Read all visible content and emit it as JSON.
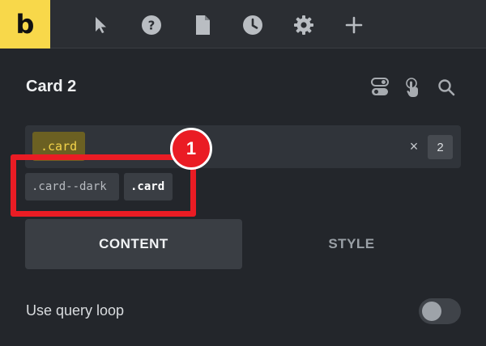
{
  "toolbar": {
    "logo_text": "b",
    "icons": [
      "cursor-icon",
      "help-icon",
      "page-icon",
      "clock-icon",
      "gear-icon",
      "plus-icon"
    ]
  },
  "panel": {
    "title": "Card 2",
    "header_icons": [
      "toggle-switches-icon",
      "touch-pointer-icon",
      "search-icon"
    ]
  },
  "class_field": {
    "active_class": ".card",
    "clear_symbol": "×",
    "count": "2"
  },
  "suggestions": [
    ".card--dark",
    ".card"
  ],
  "annotation": {
    "number": "1",
    "color": "#ea1c24"
  },
  "tabs": [
    {
      "label": "CONTENT",
      "active": true
    },
    {
      "label": "STYLE",
      "active": false
    }
  ],
  "options": {
    "query_loop_label": "Use query loop",
    "query_loop_enabled": false
  },
  "colors": {
    "brand": "#f8d84a",
    "background": "#23262b",
    "active_chip_text": "#f3d34a"
  }
}
